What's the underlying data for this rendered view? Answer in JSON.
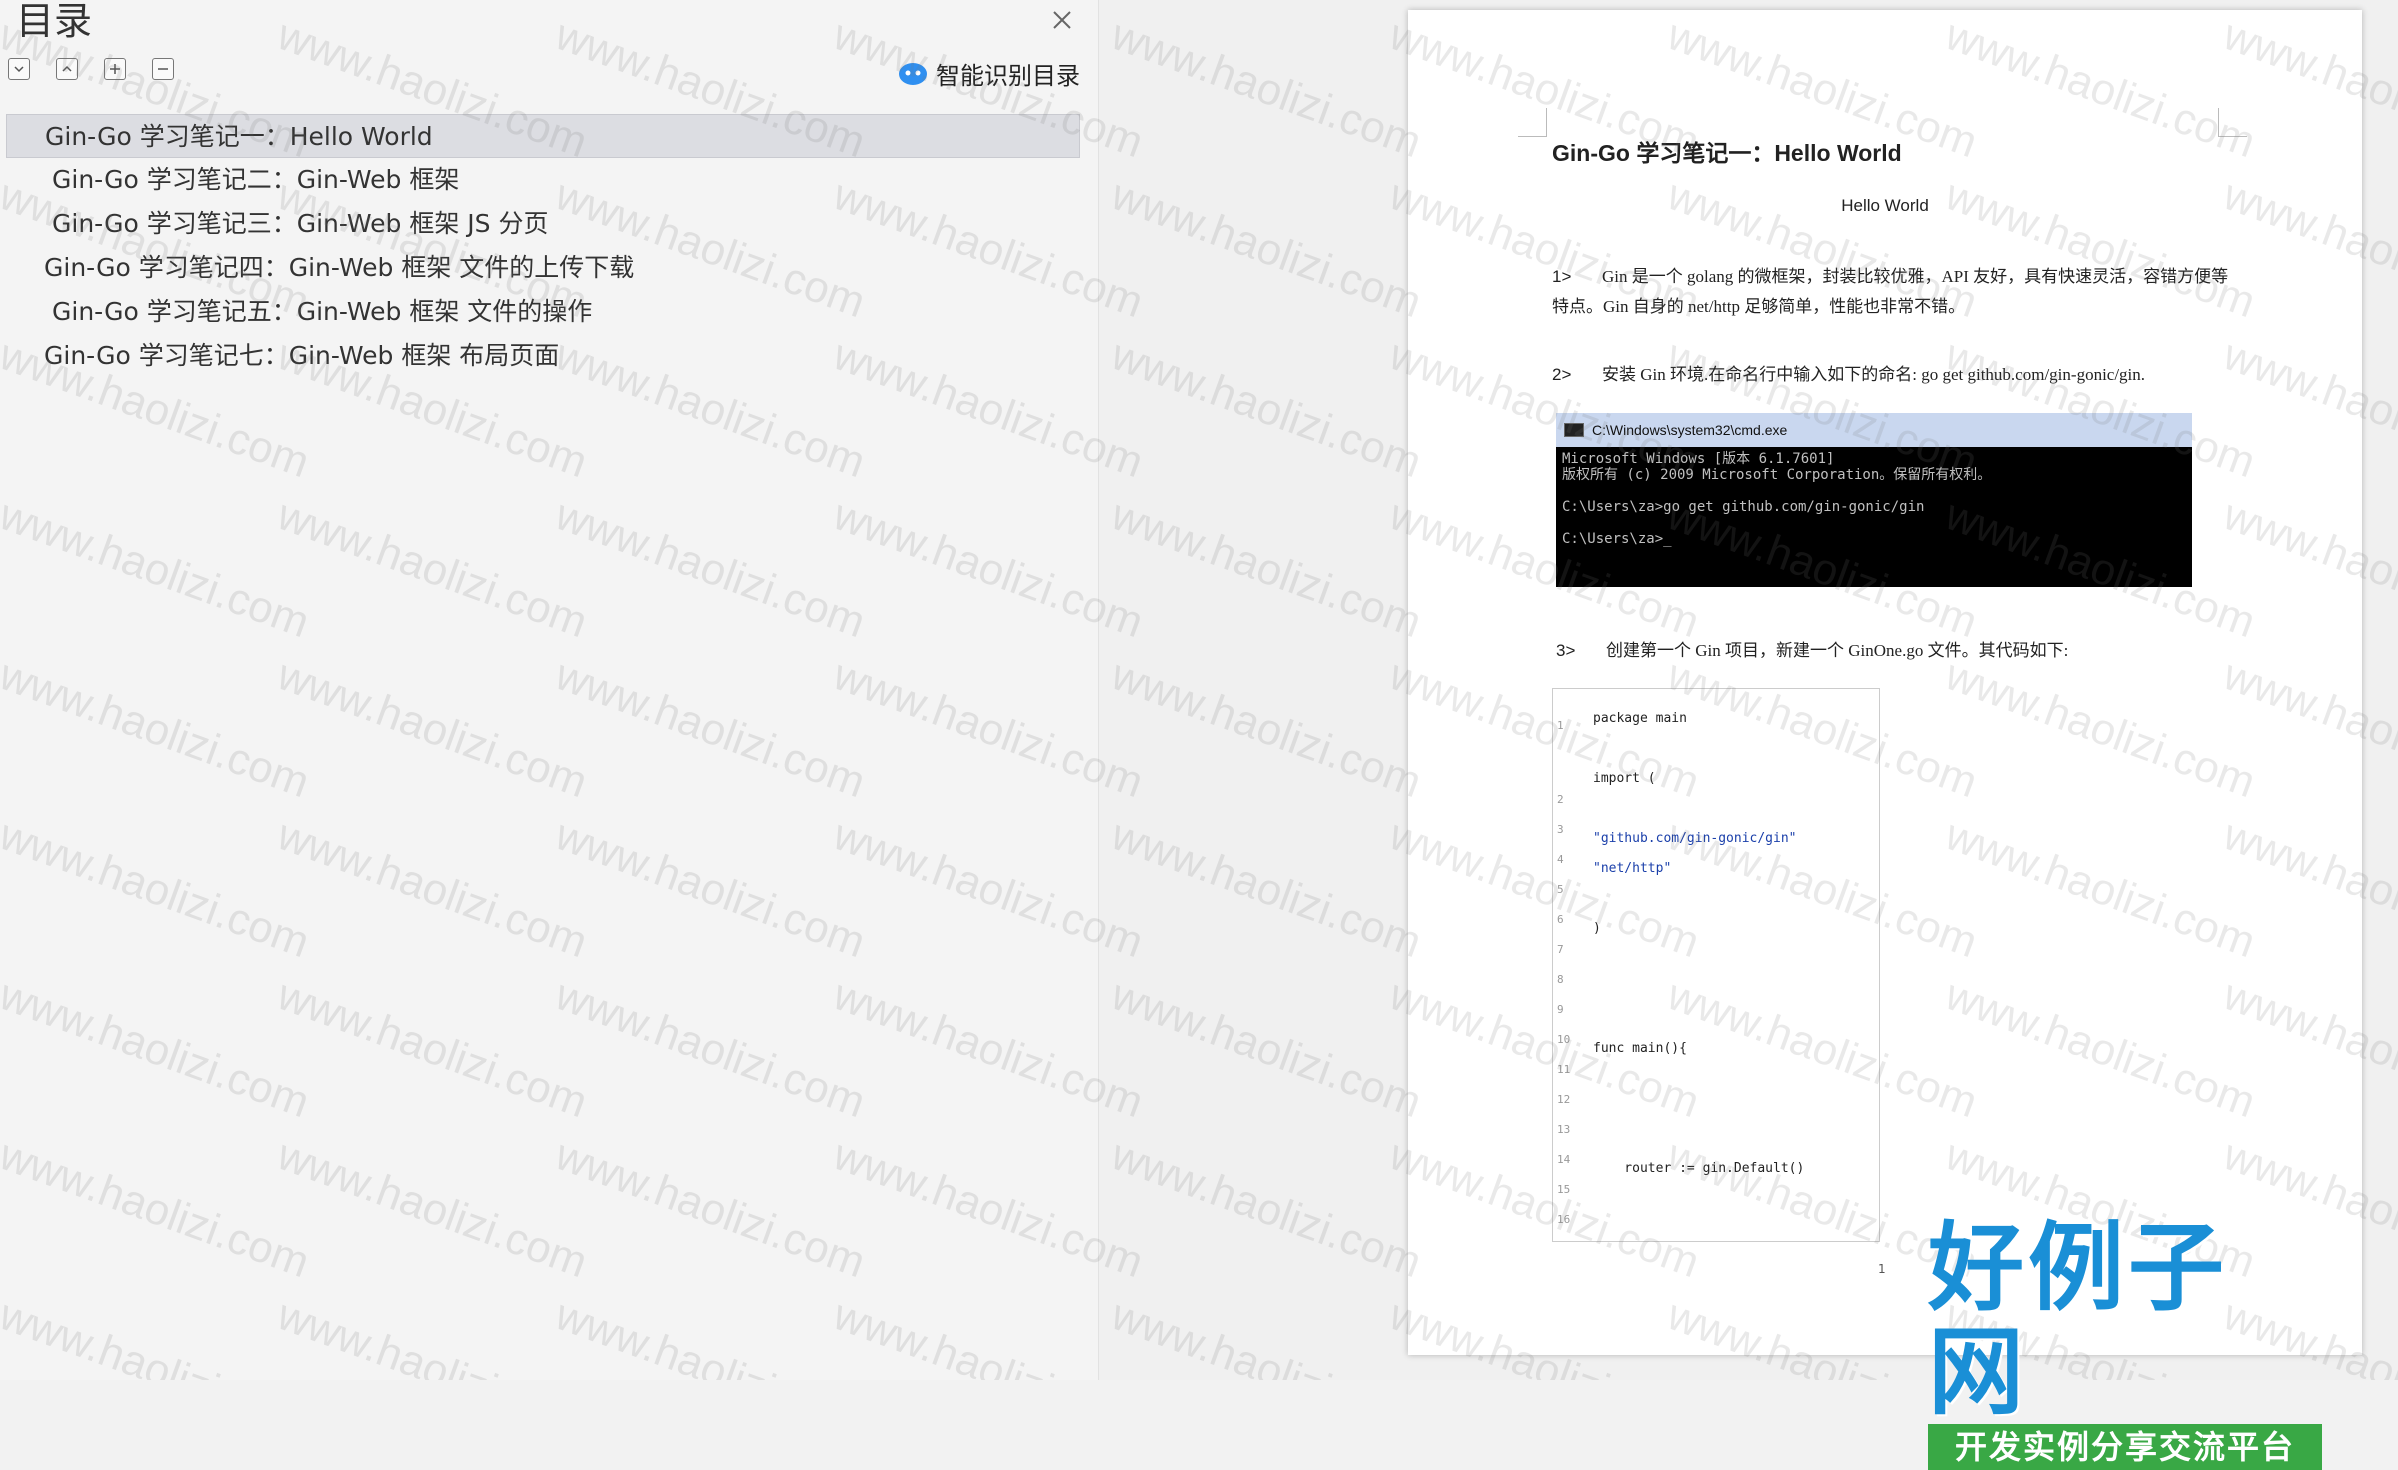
{
  "toc": {
    "title": "目录",
    "smart_label": "智能识别目录",
    "items": [
      {
        "label": "Gin-Go 学习笔记一：Hello World"
      },
      {
        "label": "Gin-Go 学习笔记二：Gin-Web 框架"
      },
      {
        "label": "Gin-Go 学习笔记三：Gin-Web 框架  JS 分页"
      },
      {
        "label": "Gin-Go 学习笔记四：Gin-Web 框架  文件的上传下载"
      },
      {
        "label": "Gin-Go 学习笔记五：Gin-Web 框架  文件的操作"
      },
      {
        "label": "Gin-Go 学习笔记七：Gin-Web 框架  布局页面"
      }
    ]
  },
  "doc": {
    "heading": "Gin-Go 学习笔记一：Hello World",
    "subtitle": "Hello World",
    "p1_num": "1>",
    "p1_text": "Gin 是一个 golang 的微框架，封装比较优雅，API 友好，具有快速灵活，容错方便等特点。Gin 自身的 net/http 足够简单，性能也非常不错。",
    "p2_num": "2>",
    "p2_text": "安装 Gin 环境.在命名行中输入如下的命名: go get github.com/gin-gonic/gin.",
    "cmd_title": "C:\\Windows\\system32\\cmd.exe",
    "cmd_lines": "Microsoft Windows [版本 6.1.7601]\n版权所有 (c) 2009 Microsoft Corporation。保留所有权利。\n\nC:\\Users\\za>go get github.com/gin-gonic/gin\n\nC:\\Users\\za>_",
    "p3_num": "3>",
    "p3_text": "创建第一个 Gin 项目，新建一个 GinOne.go 文件。其代码如下:",
    "code": {
      "line_numbers": [
        "1",
        "2",
        "3",
        "4",
        "5",
        "6",
        "7",
        "8",
        "9",
        "10",
        "11",
        "12",
        "13",
        "14",
        "15",
        "16"
      ],
      "lines": [
        "package main",
        "import (",
        "\"github.com/gin-gonic/gin\"",
        "\"net/http\"",
        ")",
        "func main(){",
        "    router := gin.Default()"
      ]
    },
    "page_number": "1"
  },
  "watermark": "www.haolizi.com",
  "logo": {
    "big": "好例子网",
    "small": "开发实例分享交流平台"
  }
}
